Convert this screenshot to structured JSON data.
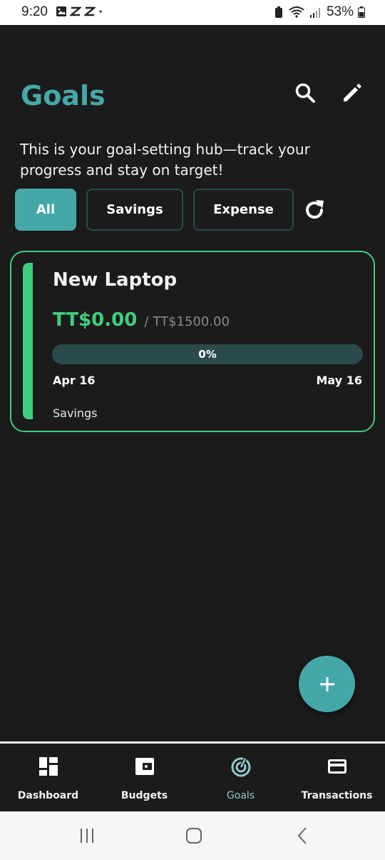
{
  "status_bar": {
    "time": "9:20",
    "battery": "53%",
    "notification_icons": [
      "gallery-icon",
      "capcut-icon",
      "capcut-icon",
      "dot-icon"
    ]
  },
  "header": {
    "title": "Goals",
    "subtitle": "This is your goal-setting hub—track your progress and stay on target!"
  },
  "filters": {
    "options": [
      "All",
      "Savings",
      "Expense"
    ],
    "selected": "All"
  },
  "goals": [
    {
      "name": "New Laptop",
      "current": "TT$0.00",
      "separator": "/",
      "target": "TT$1500.00",
      "progress_label": "0%",
      "progress_fraction": 0,
      "start_date": "Apr 16",
      "end_date": "May 16",
      "type": "Savings"
    }
  ],
  "nav": {
    "items": [
      "Dashboard",
      "Budgets",
      "Goals",
      "Transactions"
    ],
    "active": "Goals"
  },
  "colors": {
    "accent": "#45a8a8",
    "success": "#3ecf7e",
    "background": "#1b1b1b",
    "progress_track": "#2a4a4c",
    "active_nav": "#8fc9cf"
  }
}
